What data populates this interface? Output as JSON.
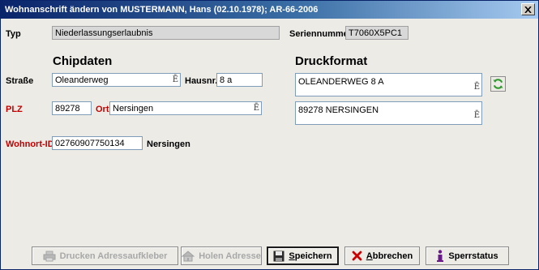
{
  "window": {
    "title": "Wohnanschrift ändern von MUSTERMANN, Hans (02.10.1978); AR-66-2006"
  },
  "typ": {
    "label": "Typ",
    "value": "Niederlassungserlaubnis"
  },
  "seriennummer": {
    "label": "Seriennummer",
    "value": "T7060X5PC1"
  },
  "chipdaten": {
    "heading": "Chipdaten",
    "strasse_label": "Straße",
    "strasse_value": "Oleanderweg",
    "hausnr_label": "Hausnr.",
    "hausnr_value": "8 a",
    "plz_label": "PLZ",
    "plz_value": "89278",
    "ort_label": "Ort",
    "ort_value": "Nersingen",
    "wohnort_id_label": "Wohnort-ID",
    "wohnort_id_value": "02760907750134",
    "wohnort_name": "Nersingen"
  },
  "druckformat": {
    "heading": "Druckformat",
    "line1": "OLEANDERWEG 8 A",
    "line2": "89278 NERSINGEN"
  },
  "field_marker": "Ē",
  "buttons": {
    "drucken": {
      "label": "Drucken Adressaufkleber",
      "enabled": false
    },
    "holen": {
      "label": "Holen Adresse",
      "enabled": false
    },
    "speichern": {
      "mnemonic": "S",
      "rest": "peichern"
    },
    "abbrechen": {
      "mnemonic": "A",
      "rest": "bbrechen"
    },
    "sperrstatus": {
      "label": "Sperrstatus"
    }
  },
  "icons": {
    "close": "close-icon",
    "refresh": "refresh-icon",
    "printer": "printer-icon",
    "house": "house-icon",
    "save": "save-disk-icon",
    "cancel": "cancel-x-icon",
    "info": "info-icon"
  },
  "colors": {
    "title_start": "#0a246a",
    "title_end": "#a6caf0",
    "required_label": "#c00000",
    "refresh_green": "#2e9a2e",
    "cancel_red": "#cc0000",
    "info_purple": "#6a1b8a"
  }
}
